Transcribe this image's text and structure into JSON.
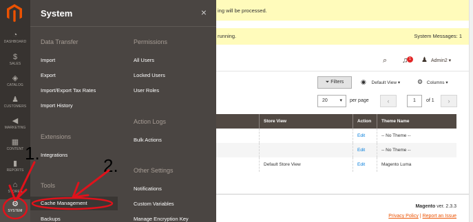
{
  "nav": {
    "items": [
      {
        "label": "DASHBOARD",
        "icon": "dashboard-icon"
      },
      {
        "label": "SALES",
        "icon": "dollar-icon"
      },
      {
        "label": "CATALOG",
        "icon": "cube-icon"
      },
      {
        "label": "CUSTOMERS",
        "icon": "person-icon"
      },
      {
        "label": "MARKETING",
        "icon": "megaphone-icon"
      },
      {
        "label": "CONTENT",
        "icon": "content-icon"
      },
      {
        "label": "REPORTS",
        "icon": "bar-chart-icon"
      },
      {
        "label": "STORES",
        "icon": "store-icon"
      },
      {
        "label": "SYSTEM",
        "icon": "gear-icon"
      }
    ]
  },
  "flyout": {
    "title": "System",
    "close": "×",
    "sections": {
      "data_transfer": "Data Transfer",
      "extensions": "Extensions",
      "tools": "Tools",
      "permissions": "Permissions",
      "action_logs": "Action Logs",
      "other_settings": "Other Settings"
    },
    "links": {
      "import": "Import",
      "export": "Export",
      "import_export_tax": "Import/Export Tax Rates",
      "import_history": "Import History",
      "integrations": "Integrations",
      "cache_management": "Cache Management",
      "backups": "Backups",
      "all_users": "All Users",
      "locked_users": "Locked Users",
      "user_roles": "User Roles",
      "bulk_actions": "Bulk Actions",
      "notifications": "Notifications",
      "custom_variables": "Custom Variables",
      "manage_encryption_key": "Manage Encryption Key"
    }
  },
  "main": {
    "message1": "ing will be processed.",
    "message2": "running.",
    "system_messages": "System Messages: 1",
    "notification_count": "1",
    "user": "Admin2",
    "filters_label": "Filters",
    "view_label": "Default View",
    "columns_label": "Columns",
    "per_page_value": "20",
    "per_page_label": "per page",
    "page_value": "1",
    "page_of": "of 1",
    "table": {
      "headers": [
        "Store View",
        "Action",
        "Theme Name"
      ],
      "rows": [
        {
          "store_view": "",
          "action": "Edit",
          "theme": "-- No Theme --"
        },
        {
          "store_view": "",
          "action": "Edit",
          "theme": "-- No Theme --"
        },
        {
          "store_view": "Default Store View",
          "action": "Edit",
          "theme": "Magento Luma"
        }
      ]
    },
    "footer": {
      "product": "Magento",
      "version": " ver. 2.3.3",
      "privacy": "Privacy Policy",
      "separator": " | ",
      "report": "Report an Issue"
    }
  },
  "annotations": {
    "step1": "1.",
    "step2": "2.",
    "color": "#e0121b"
  }
}
